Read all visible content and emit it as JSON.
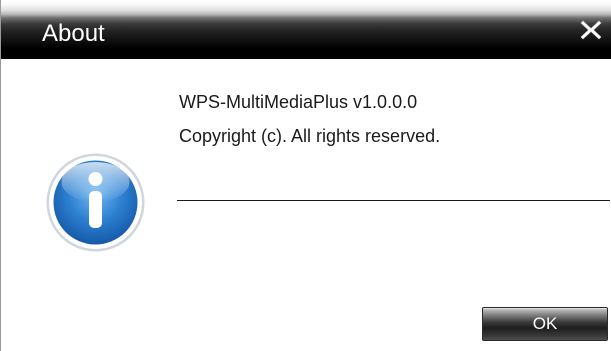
{
  "window": {
    "title": "About",
    "close_glyph": "X"
  },
  "content": {
    "app_name": "WPS-MultiMediaPlus v1.0.0.0",
    "copyright": "Copyright (c). All rights reserved.",
    "icon": "info-icon"
  },
  "buttons": {
    "ok_label": "OK"
  },
  "colors": {
    "titlebar": "#000000",
    "title_text": "#ffffff",
    "info_blue": "#2a78c4"
  }
}
